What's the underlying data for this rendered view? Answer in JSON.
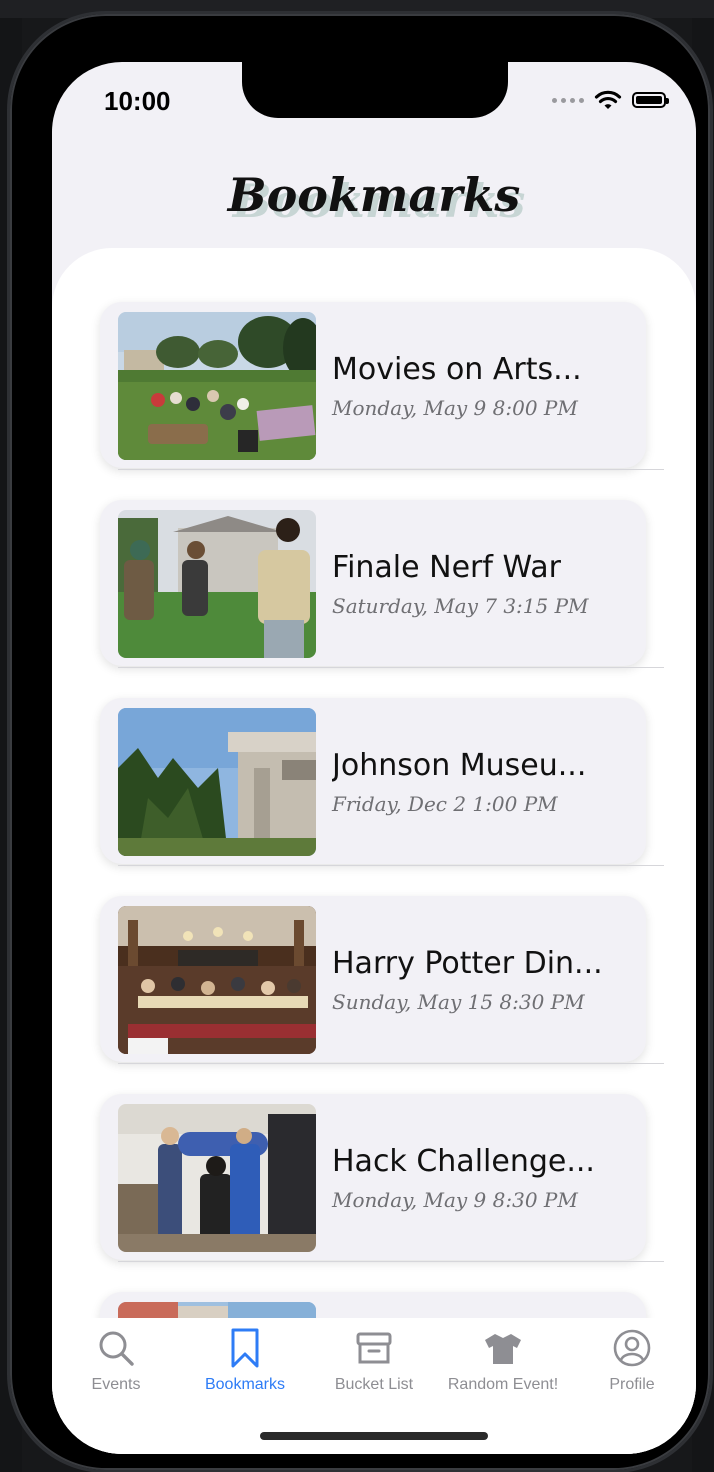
{
  "app": {
    "status_time": "10:00",
    "page_title": "Bookmarks"
  },
  "bookmarks": [
    {
      "title": "Movies on Arts...",
      "date": "Monday, May 9 8:00 PM",
      "image": "outdoor-lawn-movie-crowd-photo"
    },
    {
      "title": "Finale Nerf War",
      "date": "Saturday, May 7 3:15 PM",
      "image": "nerf-war-players-photo"
    },
    {
      "title": "Johnson Museu...",
      "date": "Friday, Dec 2 1:00 PM",
      "image": "museum-building-photo"
    },
    {
      "title": "Harry Potter Din...",
      "date": "Sunday, May 15 8:30 PM",
      "image": "great-hall-dinner-photo"
    },
    {
      "title": "Hack Challenge...",
      "date": "Monday, May 9 8:30 PM",
      "image": "group-holding-pillow-photo"
    }
  ],
  "tabs": [
    {
      "label": "Events",
      "icon": "magnifying-glass-icon",
      "active": false
    },
    {
      "label": "Bookmarks",
      "icon": "bookmark-icon",
      "active": true
    },
    {
      "label": "Bucket List",
      "icon": "archive-box-icon",
      "active": false
    },
    {
      "label": "Random Event!",
      "icon": "shirt-icon",
      "active": false
    },
    {
      "label": "Profile",
      "icon": "person-circle-icon",
      "active": false
    }
  ],
  "colors": {
    "accent": "#2e7cf6",
    "inactive_tab": "#8e8e93",
    "card_bg": "#f2f1f6"
  }
}
